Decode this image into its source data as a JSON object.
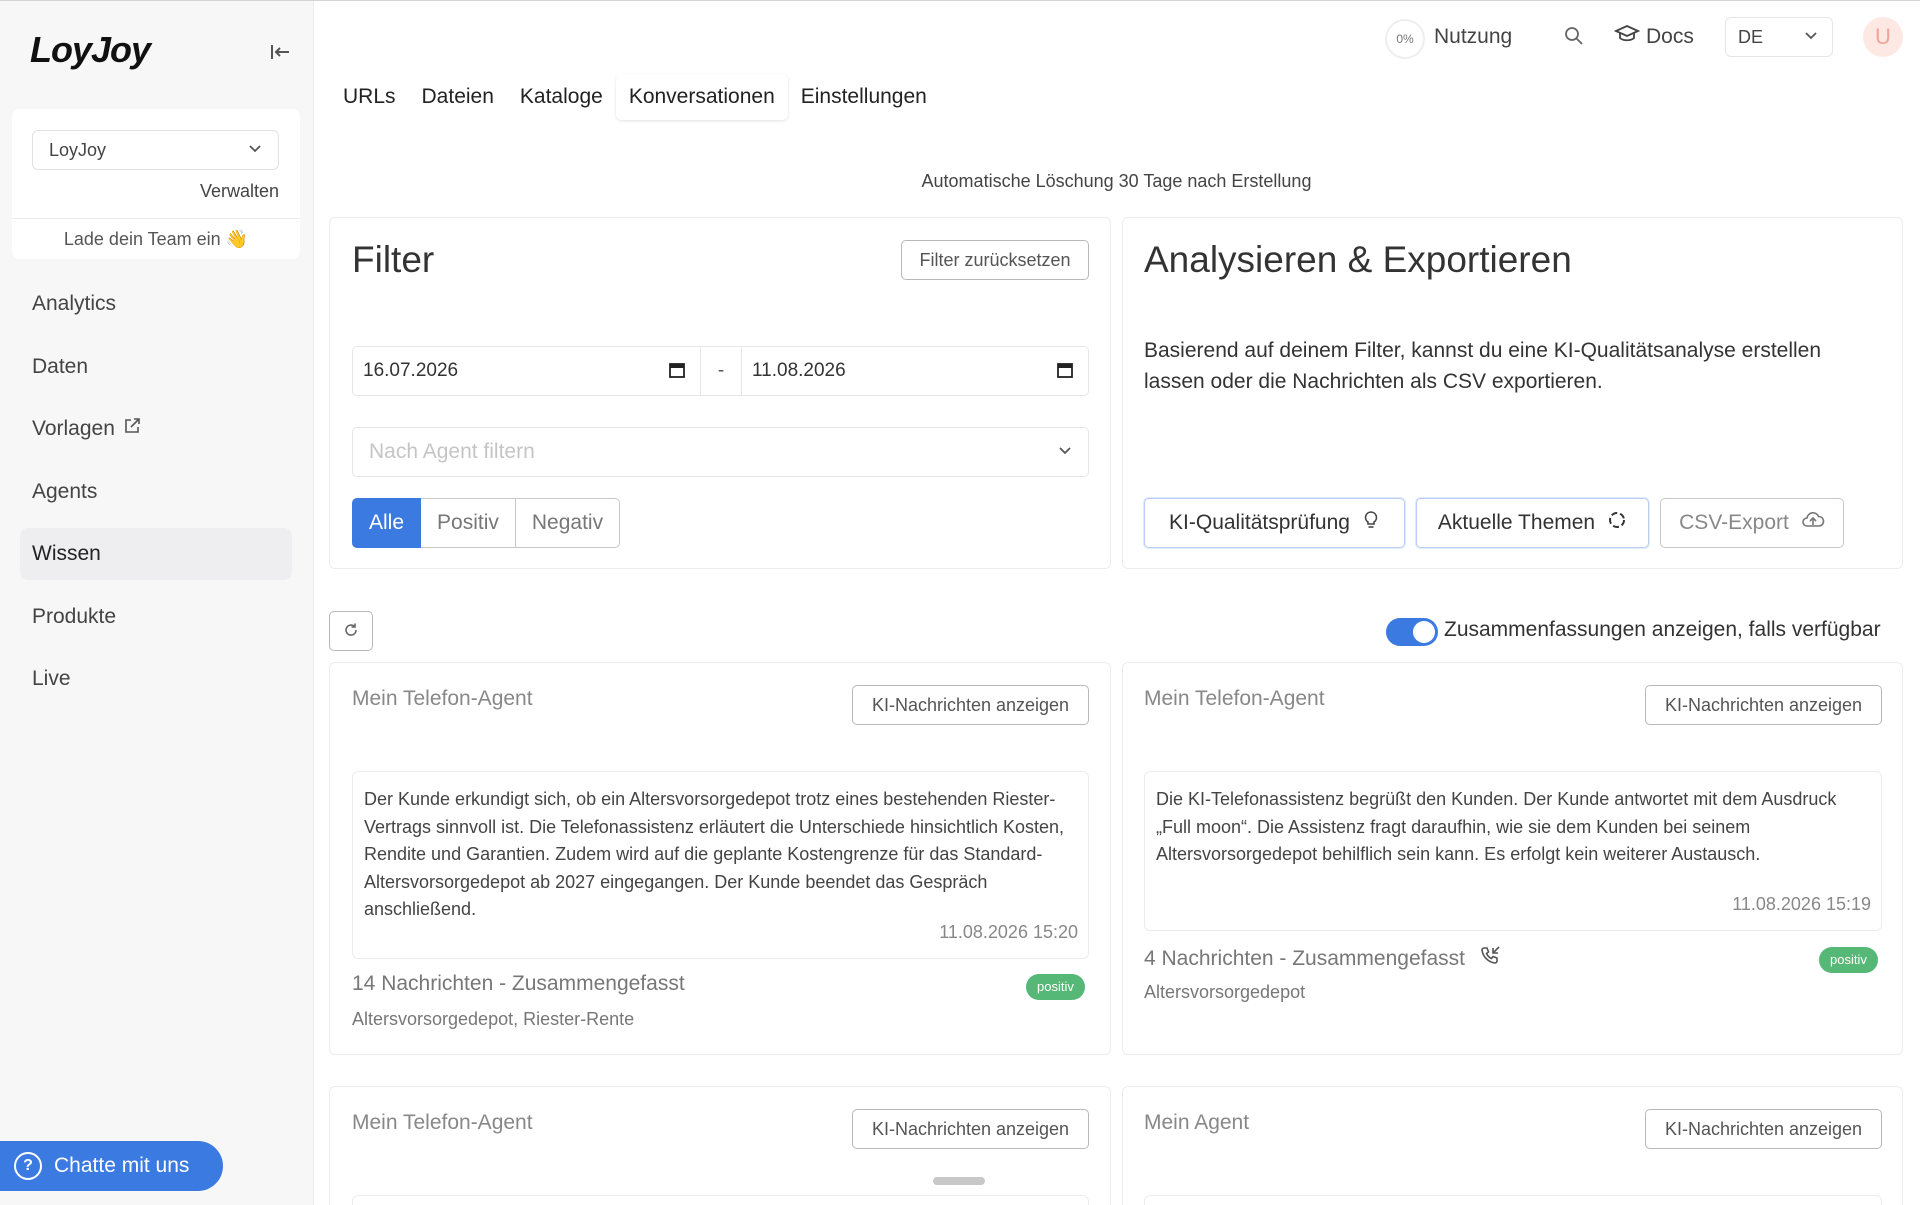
{
  "sidebar": {
    "logo": "LoyJoy",
    "team": {
      "selected": "LoyJoy",
      "manage": "Verwalten",
      "invite": "Lade dein Team ein 👋"
    },
    "nav": [
      {
        "label": "Analytics"
      },
      {
        "label": "Daten"
      },
      {
        "label": "Vorlagen",
        "external": true
      },
      {
        "label": "Agents"
      },
      {
        "label": "Wissen",
        "active": true
      },
      {
        "label": "Produkte"
      },
      {
        "label": "Live"
      }
    ],
    "chat_label": "Chatte mit uns"
  },
  "topbar": {
    "usage_percent": "0%",
    "usage_label": "Nutzung",
    "docs_label": "Docs",
    "language": "DE",
    "avatar_initial": "U"
  },
  "tabs": [
    {
      "label": "URLs"
    },
    {
      "label": "Dateien"
    },
    {
      "label": "Kataloge"
    },
    {
      "label": "Konversationen",
      "active": true
    },
    {
      "label": "Einstellungen"
    }
  ],
  "deletion_note": "Automatische Löschung 30 Tage nach Erstellung",
  "filter": {
    "title": "Filter",
    "reset_label": "Filter zurücksetzen",
    "date_from": "16.07.2026",
    "date_separator": "-",
    "date_to": "11.08.2026",
    "agent_placeholder": "Nach Agent filtern",
    "sentiment": [
      "Alle",
      "Positiv",
      "Negativ"
    ]
  },
  "analyze": {
    "title": "Analysieren & Exportieren",
    "description": "Basierend auf deinem Filter, kannst du eine KI-Qualitätsanalyse erstellen lassen oder die Nachrichten als CSV exportieren.",
    "quality_label": "KI-Qualitätsprüfung",
    "topics_label": "Aktuelle Themen",
    "csv_label": "CSV-Export"
  },
  "summaries_toggle_label": "Zusammenfassungen anzeigen, falls verfügbar",
  "show_messages_label": "KI-Nachrichten anzeigen",
  "conversations": [
    {
      "agent": "Mein Telefon-Agent",
      "summary": "Der Kunde erkundigt sich, ob ein Altersvorsorgedepot trotz eines bestehenden Riester-Vertrags sinnvoll ist. Die Telefonassistenz erläutert die Unterschiede hinsichtlich Kosten, Rendite und Garantien. Zudem wird auf die geplante Kostengrenze für das Standard-Altersvorsorgedepot ab 2027 eingegangen. Der Kunde beendet das Gespräch anschließend.",
      "timestamp": "11.08.2026 15:20",
      "messages": "14 Nachrichten - Zusammengefasst",
      "sentiment": "positiv",
      "tags": "Altersvorsorgedepot, Riester-Rente"
    },
    {
      "agent": "Mein Telefon-Agent",
      "summary": "Die KI-Telefonassistenz begrüßt den Kunden. Der Kunde antwortet mit dem Ausdruck „Full moon“. Die Assistenz fragt daraufhin, wie sie dem Kunden bei seinem Altersvorsorgedepot behilflich sein kann. Es erfolgt kein weiterer Austausch.",
      "timestamp": "11.08.2026 15:19",
      "messages": "4 Nachrichten - Zusammengefasst",
      "sentiment": "positiv",
      "tags": "Altersvorsorgedepot"
    },
    {
      "agent": "Mein Telefon-Agent"
    },
    {
      "agent": "Mein Agent"
    }
  ]
}
